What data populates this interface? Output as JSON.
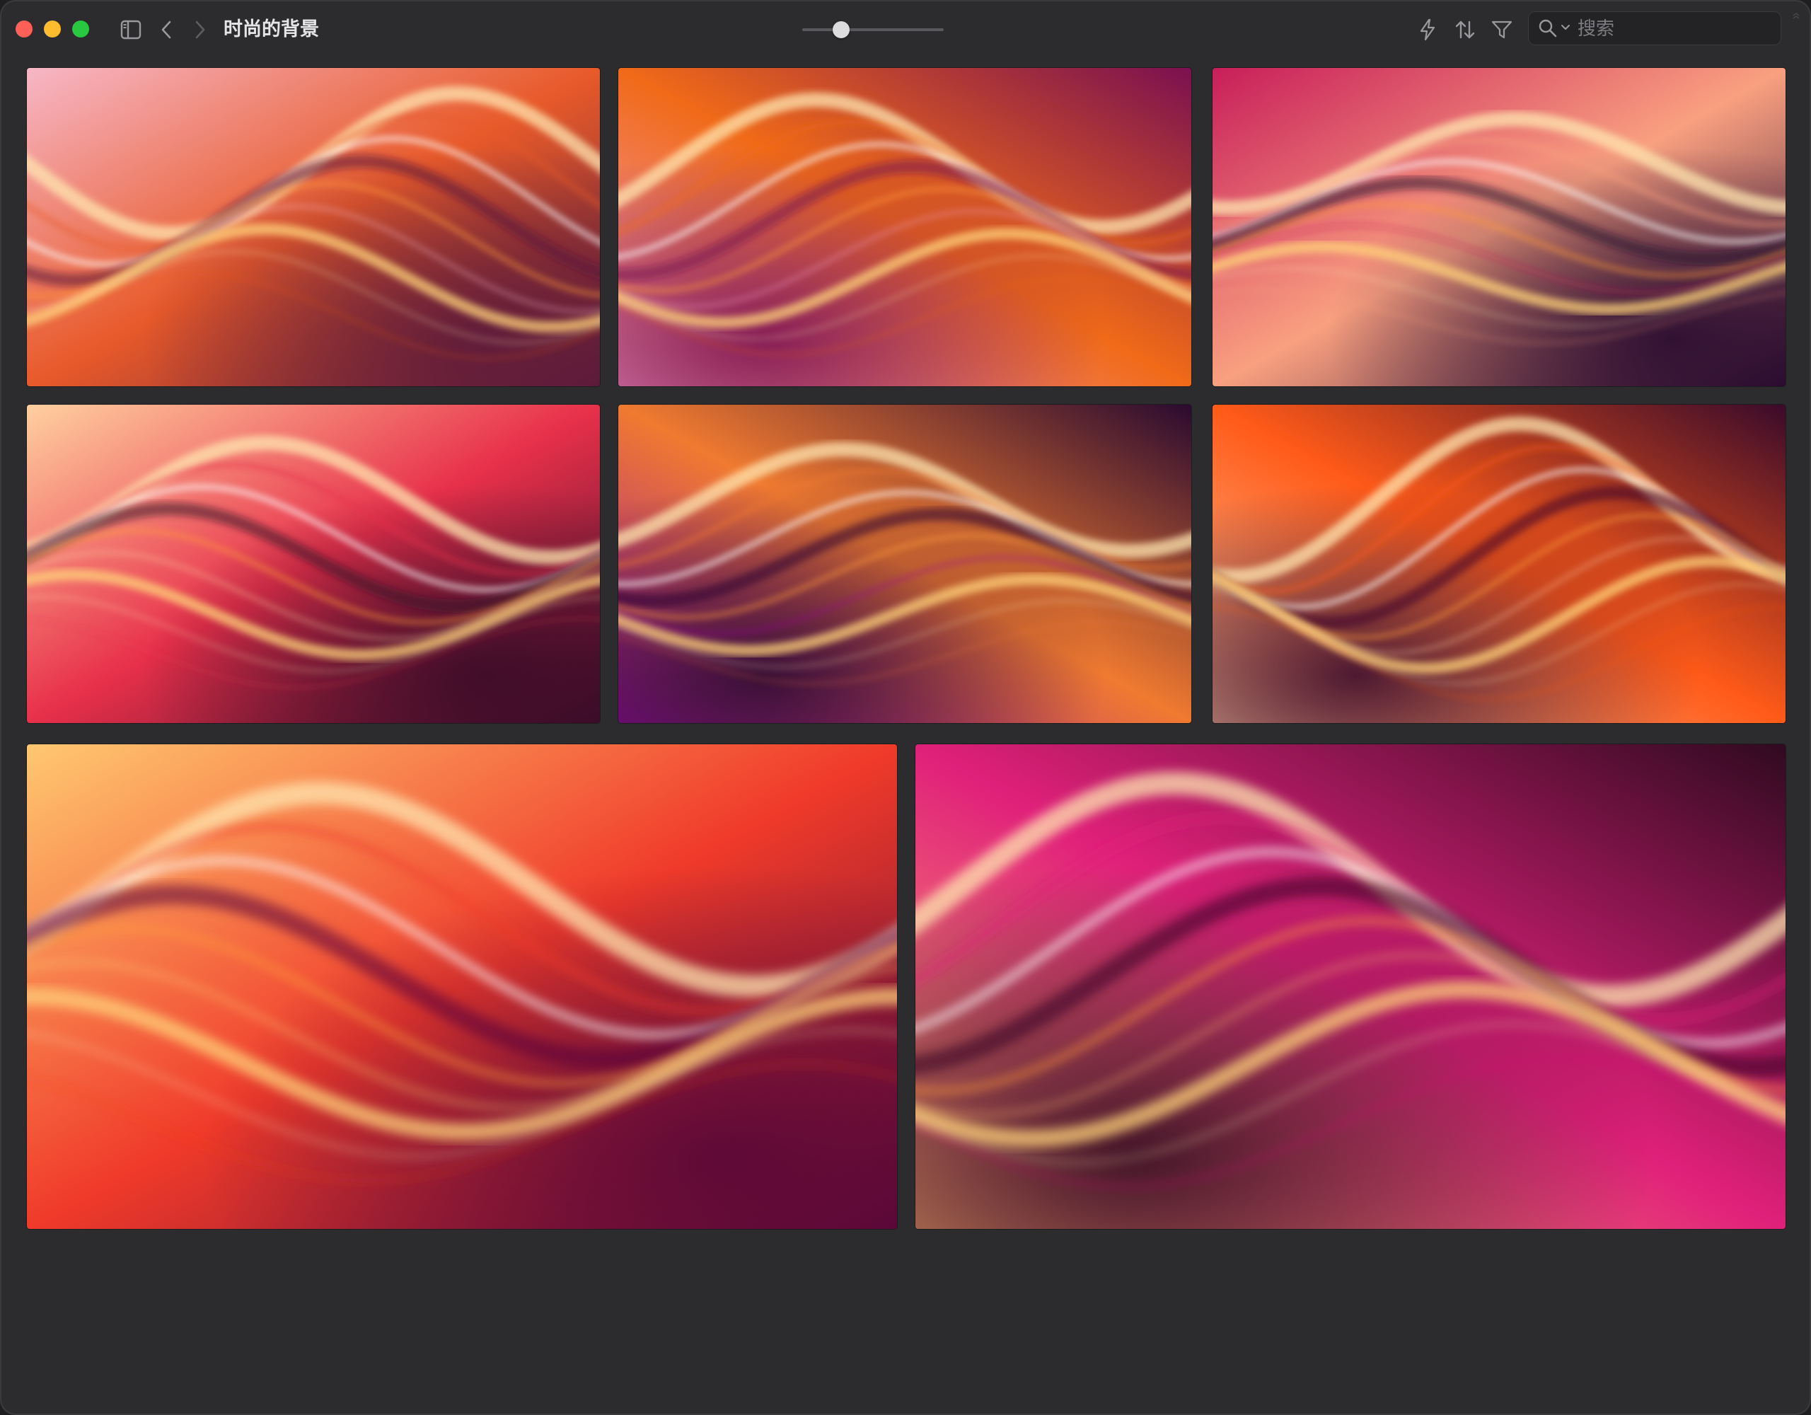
{
  "window": {
    "title": "时尚的背景"
  },
  "toolbar": {
    "sidebar_toggle_icon": "sidebar-icon",
    "back_icon": "chevron-left-icon",
    "forward_icon": "chevron-right-icon",
    "zoom_slider": {
      "value": 0.28
    },
    "actions": [
      "bolt-icon",
      "sort-icon",
      "filter-icon"
    ],
    "search": {
      "placeholder": "搜索",
      "value": ""
    }
  },
  "gallery": {
    "count": 8,
    "items": [
      {
        "name": "wallpaper-1",
        "colors": [
          "#f7b7c7",
          "#e85a2a",
          "#5c1a3a"
        ]
      },
      {
        "name": "wallpaper-2",
        "colors": [
          "#f5a0c8",
          "#f06a18",
          "#7a1050"
        ]
      },
      {
        "name": "wallpaper-3",
        "colors": [
          "#c81e5a",
          "#f9a080",
          "#2a0c30"
        ]
      },
      {
        "name": "wallpaper-4",
        "colors": [
          "#ffd0a0",
          "#e8304a",
          "#3a0c28"
        ]
      },
      {
        "name": "wallpaper-5",
        "colors": [
          "#9a10a0",
          "#f07a30",
          "#2a0a30"
        ]
      },
      {
        "name": "wallpaper-6",
        "colors": [
          "#ffc8a0",
          "#ff5a18",
          "#3a0a2a"
        ]
      },
      {
        "name": "wallpaper-7",
        "colors": [
          "#ffc870",
          "#f03a2a",
          "#5a0838"
        ]
      },
      {
        "name": "wallpaper-8",
        "colors": [
          "#ffb070",
          "#e0207a",
          "#300a20"
        ]
      }
    ]
  }
}
